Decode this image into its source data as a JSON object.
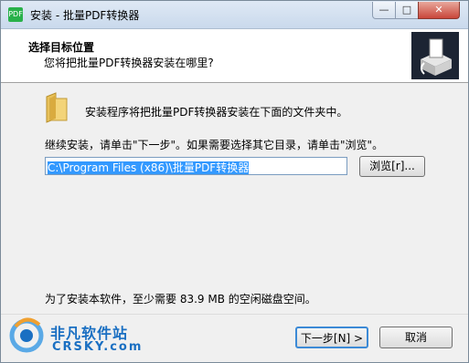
{
  "window": {
    "title": "安装 - 批量PDF转换器",
    "app_icon_text": "PDF",
    "minimize_glyph": "—",
    "maximize_glyph": "□",
    "close_glyph": "✕"
  },
  "header": {
    "title": "选择目标位置",
    "subtitle": "您将把批量PDF转换器安装在哪里?"
  },
  "body": {
    "intro": "安装程序将把批量PDF转换器安装在下面的文件夹中。",
    "instruction": "继续安装，请单击\"下一步\"。如果需要选择其它目录，请单击\"浏览\"。",
    "path_value": "C:\\Program Files (x86)\\批量PDF转换器",
    "browse_label": "浏览[r]...",
    "space_text": "为了安装本软件，至少需要 83.9 MB 的空闲磁盘空间。"
  },
  "footer": {
    "next_label": "下一步[N] >",
    "cancel_label": "取消"
  },
  "watermark": {
    "brand_cn": "非凡软件站",
    "brand_en": "CRSKY.com"
  },
  "icons": {
    "app": "pdf-app-icon",
    "folder": "folder-icon",
    "header_logo": "install-box-icon",
    "watermark": "crsky-logo-icon"
  },
  "colors": {
    "selection": "#3399ff",
    "default_button_border": "#3c8ad6",
    "watermark_blue": "#1a6fc2"
  }
}
